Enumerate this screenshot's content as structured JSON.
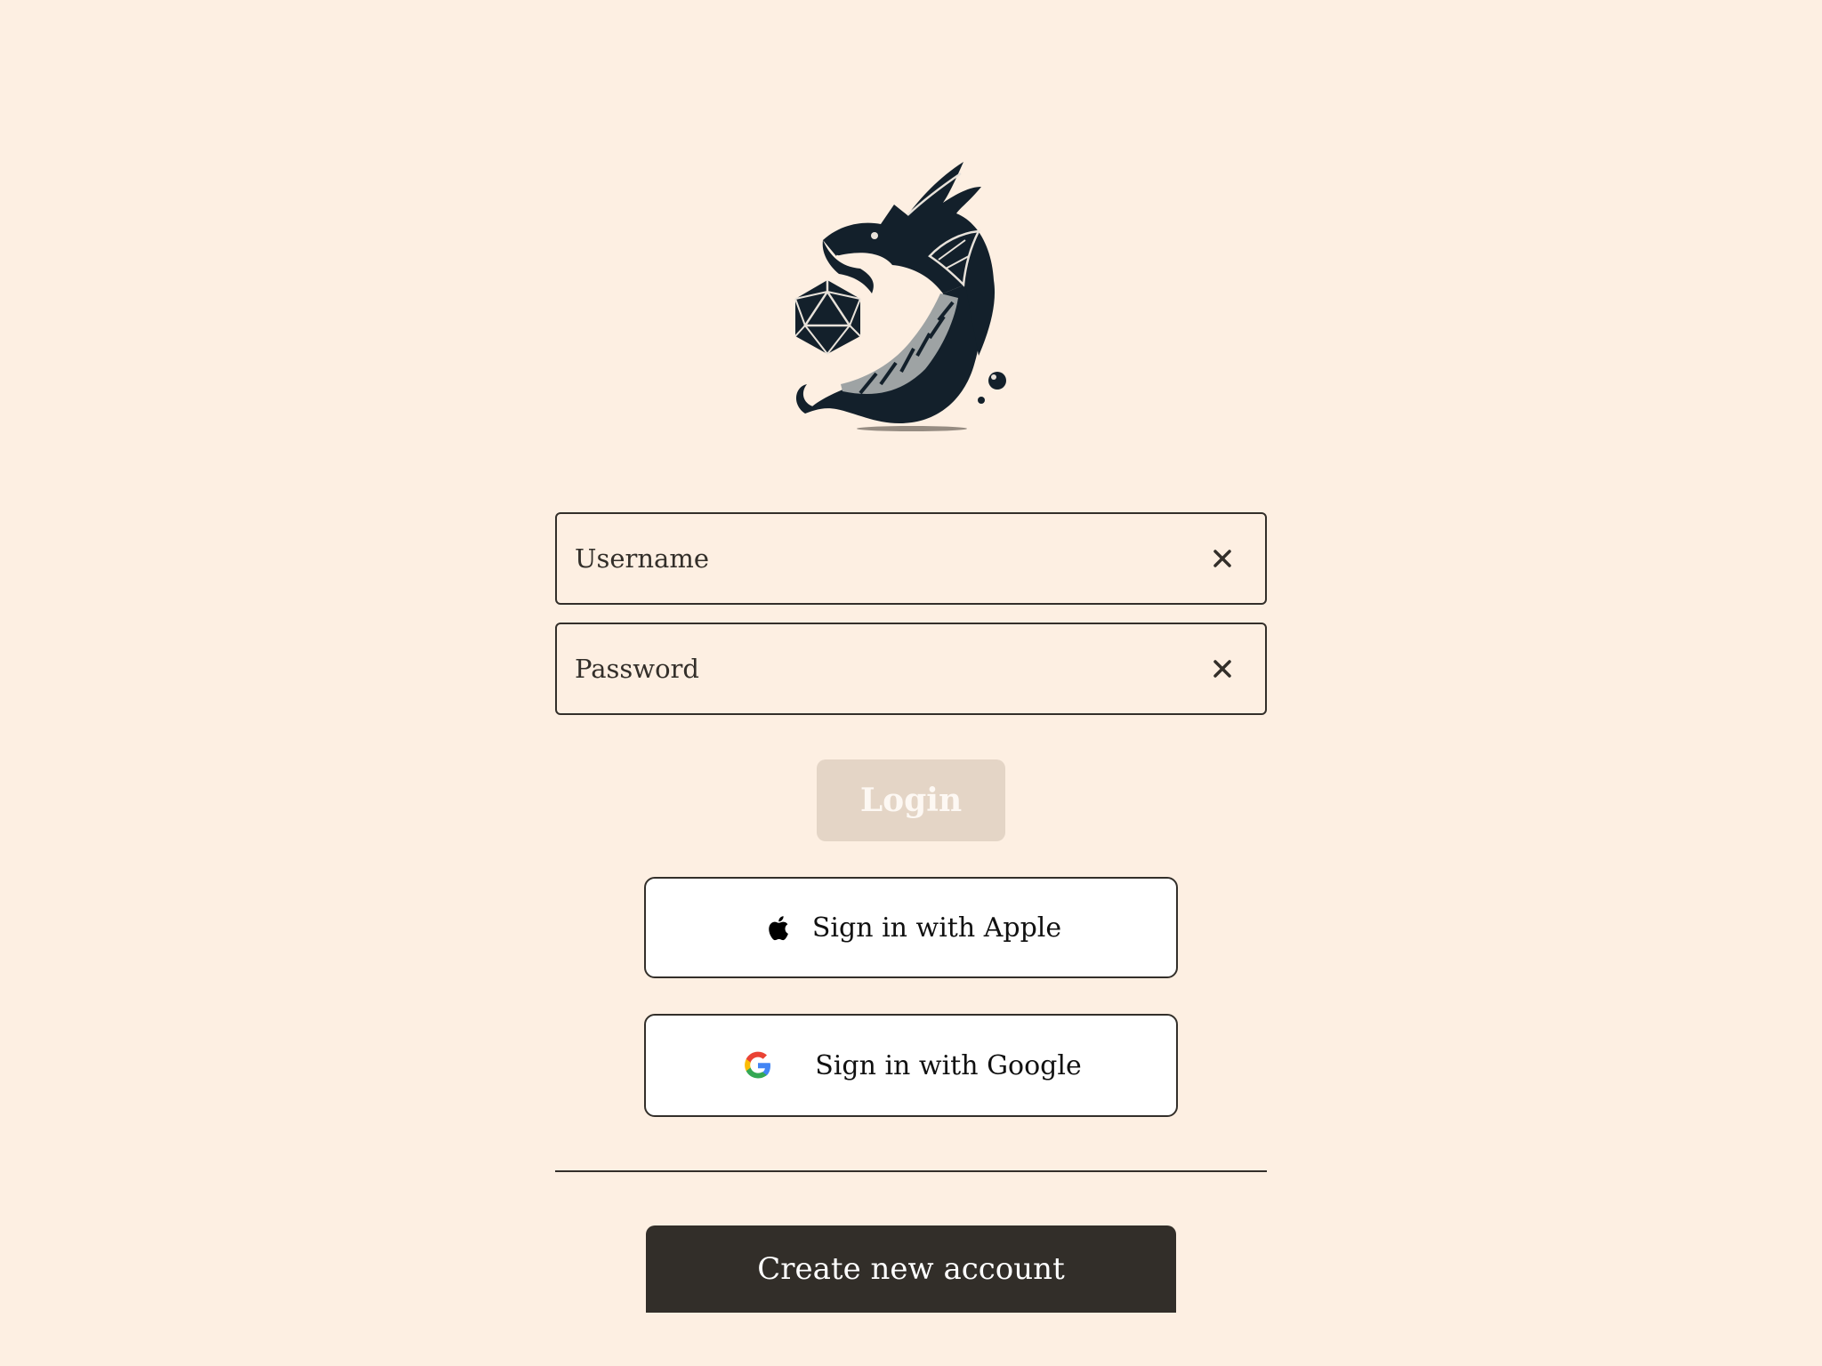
{
  "colors": {
    "background": "#fdefe2",
    "text": "#332f2a",
    "login_disabled_bg": "#e4d5c6",
    "create_account_bg": "#322e29"
  },
  "logo": {
    "icon": "dragon-d20-logo"
  },
  "username": {
    "placeholder": "Username",
    "value": "",
    "clear_icon": "close-icon"
  },
  "password": {
    "placeholder": "Password",
    "value": "",
    "clear_icon": "close-icon"
  },
  "login": {
    "label": "Login",
    "state": "disabled"
  },
  "apple": {
    "label": "Sign in with Apple",
    "icon": "apple-icon"
  },
  "google": {
    "label": "Sign in with Google",
    "icon": "google-icon"
  },
  "create_account": {
    "label": "Create new account"
  }
}
